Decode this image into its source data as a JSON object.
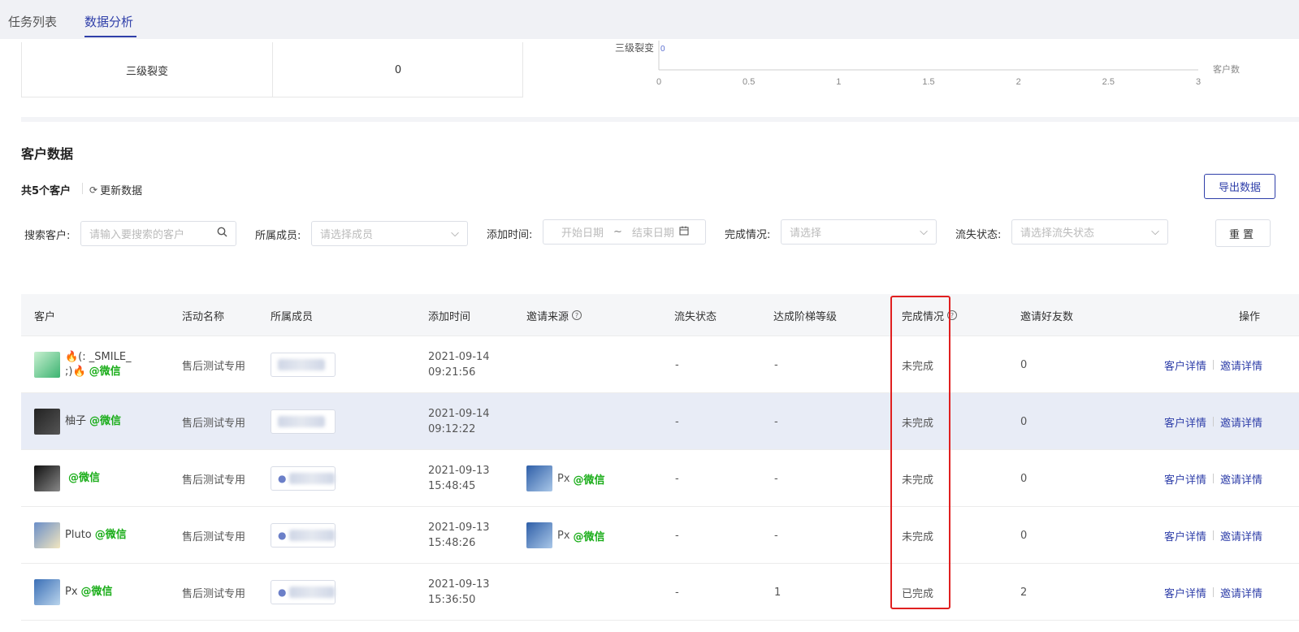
{
  "tabs": [
    {
      "label": "任务列表",
      "active": false
    },
    {
      "label": "数据分析",
      "active": true
    }
  ],
  "top_table": {
    "label": "三级裂变",
    "value": "0"
  },
  "chart_data": {
    "type": "bar",
    "orientation": "horizontal",
    "categories": [
      "三级裂变"
    ],
    "values": [
      0
    ],
    "xlabel": "客户数",
    "xlim": [
      0,
      3
    ],
    "xticks": [
      "0",
      "0.5",
      "1",
      "1.5",
      "2",
      "2.5",
      "3"
    ],
    "data_labels": [
      "0"
    ]
  },
  "section": {
    "title": "客户数据",
    "total": "共5个客户",
    "refresh": "更新数据",
    "export": "导出数据"
  },
  "filters": {
    "search_label": "搜索客户:",
    "search_placeholder": "请输入要搜索的客户",
    "member_label": "所属成员:",
    "member_placeholder": "请选择成员",
    "time_label": "添加时间:",
    "start_placeholder": "开始日期",
    "range_sep": "~",
    "end_placeholder": "结束日期",
    "complete_label": "完成情况:",
    "complete_placeholder": "请选择",
    "churn_label": "流失状态:",
    "churn_placeholder": "请选择流失状态",
    "reset": "重置"
  },
  "table": {
    "headers": {
      "customer": "客户",
      "activity": "活动名称",
      "member": "所属成员",
      "add_time": "添加时间",
      "source": "邀请来源",
      "churn": "流失状态",
      "level": "达成阶梯等级",
      "complete": "完成情况",
      "friends": "邀请好友数",
      "actions": "操作"
    },
    "rows": [
      {
        "name": "🔥(: _SMILE_",
        "name2": ";)🔥",
        "wx": "@微信",
        "activity": "售后测试专用",
        "date": "2021-09-14",
        "time": "09:21:56",
        "src_name": "",
        "src_wx": "",
        "churn": "-",
        "level": "-",
        "complete": "未完成",
        "friends": "0",
        "detail": "客户详情",
        "invite": "邀请详情"
      },
      {
        "name": "柚子",
        "name2": "",
        "wx": "@微信",
        "activity": "售后测试专用",
        "date": "2021-09-14",
        "time": "09:12:22",
        "src_name": "",
        "src_wx": "",
        "churn": "-",
        "level": "-",
        "complete": "未完成",
        "friends": "0",
        "detail": "客户详情",
        "invite": "邀请详情"
      },
      {
        "name": "",
        "name2": "",
        "wx": "@微信",
        "activity": "售后测试专用",
        "date": "2021-09-13",
        "time": "15:48:45",
        "src_name": "Px",
        "src_wx": "@微信",
        "churn": "-",
        "level": "-",
        "complete": "未完成",
        "friends": "0",
        "detail": "客户详情",
        "invite": "邀请详情"
      },
      {
        "name": "Pluto",
        "name2": "",
        "wx": "@微信",
        "activity": "售后测试专用",
        "date": "2021-09-13",
        "time": "15:48:26",
        "src_name": "Px",
        "src_wx": "@微信",
        "churn": "-",
        "level": "-",
        "complete": "未完成",
        "friends": "0",
        "detail": "客户详情",
        "invite": "邀请详情"
      },
      {
        "name": "Px",
        "name2": "",
        "wx": "@微信",
        "activity": "售后测试专用",
        "date": "2021-09-13",
        "time": "15:36:50",
        "src_name": "",
        "src_wx": "",
        "churn": "-",
        "level": "1",
        "complete": "已完成",
        "friends": "2",
        "detail": "客户详情",
        "invite": "邀请详情"
      }
    ]
  },
  "colors": {
    "accent": "#2f3fa9",
    "wechat_green": "#1aad19",
    "highlight_row": "#e8ecf6",
    "annotation_red": "#e02020"
  }
}
